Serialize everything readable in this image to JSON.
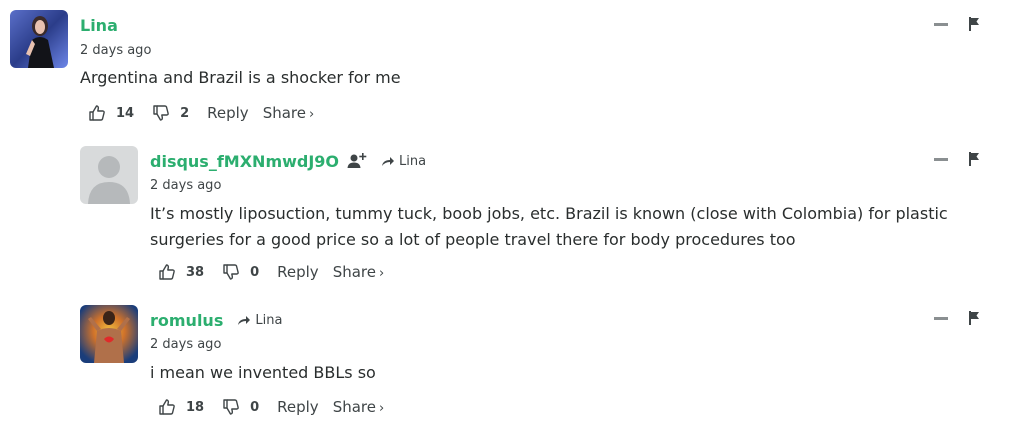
{
  "comments": [
    {
      "author": "Lina",
      "time": "2 days ago",
      "text": "Argentina and Brazil is a shocker for me",
      "upvotes": "14",
      "downvotes": "2",
      "reply_label": "Reply",
      "share_label": "Share",
      "share_arrow": "›"
    },
    {
      "author": "disqus_fMXNmwdJ9O",
      "reply_to": "Lina",
      "time": "2 days ago",
      "text": "It’s mostly liposuction, tummy tuck, boob jobs, etc. Brazil is known (close with Colombia) for plastic surgeries for a good price so a lot of people travel there for body procedures too",
      "upvotes": "38",
      "downvotes": "0",
      "reply_label": "Reply",
      "share_label": "Share",
      "share_arrow": "›"
    },
    {
      "author": "romulus",
      "reply_to": "Lina",
      "time": "2 days ago",
      "text": "i mean we invented BBLs so",
      "upvotes": "18",
      "downvotes": "0",
      "reply_label": "Reply",
      "share_label": "Share",
      "share_arrow": "›"
    }
  ],
  "colors": {
    "author": "#2cae6f",
    "text": "#2a2e2e",
    "muted": "#3f4547",
    "icon": "#8a8f91"
  },
  "icons": [
    "thumbs-up-icon",
    "thumbs-down-icon",
    "collapse-icon",
    "flag-icon",
    "follow-icon",
    "reply-arrow-icon"
  ]
}
